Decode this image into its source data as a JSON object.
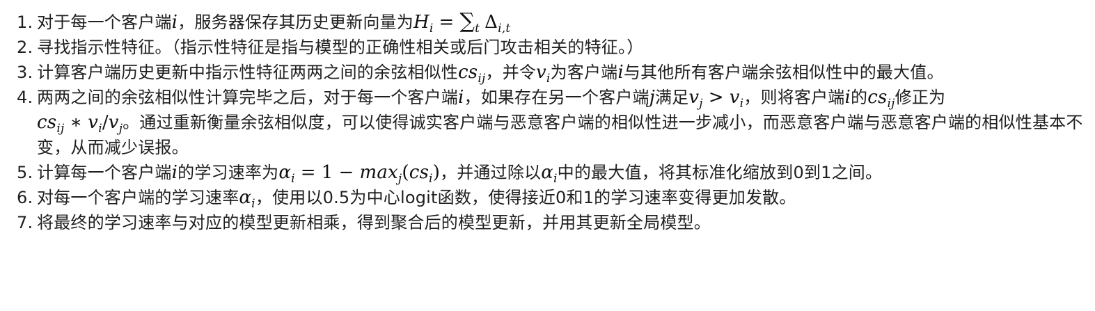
{
  "steps": [
    {
      "n": "1.",
      "t1": "对于每一个客户端",
      "t2": "，服务器保存其历史更新向量为",
      "m_i": "i",
      "m_H": "H",
      "m_H_sub": "i",
      "m_eq": "=",
      "m_sum": "∑",
      "m_sum_sub": "t",
      "m_delta": "Δ",
      "m_delta_sub": "i,t"
    },
    {
      "n": "2.",
      "text": "寻找指示性特征。（指示性特征是指与模型的正确性相关或后门攻击相关的特征。）"
    },
    {
      "n": "3.",
      "t1": "计算客户端历史更新中指示性特征两两之间的余弦相似性",
      "m_cs": "cs",
      "m_cs_sub": "ij",
      "t2": "，并令",
      "m_v": "v",
      "m_v_sub": "i",
      "t3": "为客户端",
      "m_i": "i",
      "t4": "与其他所有客户端余弦相似性中的最大值。"
    },
    {
      "n": "4.",
      "t1": "两两之间的余弦相似性计算完毕之后，对于每一个客户端",
      "m_i": "i",
      "t2": "，如果存在另一个客户端",
      "m_j": "j",
      "t3": "满足",
      "m_vj": "v",
      "m_vj_sub": "j",
      "m_gt": ">",
      "m_vi": "v",
      "m_vi_sub": "i",
      "t4": "，则将客户端",
      "m_i2": "i",
      "t5": "的",
      "m_cs": "cs",
      "m_cs_sub": "ij",
      "t6": "修正为",
      "m_cs2": "cs",
      "m_cs2_sub": "ij",
      "m_star": "∗",
      "m_v2": "v",
      "m_v2_sub": "i",
      "m_slash": "/",
      "m_v3": "v",
      "m_v3_sub": "j",
      "t7": "。通过重新衡量余弦相似度，可以使得诚实客户端与恶意客户端的相似性进一步减小，而恶意客户端与恶意客户端的相似性基本不变，从而减少误报。"
    },
    {
      "n": "5.",
      "t1": "计算每一个客户端",
      "m_i": "i",
      "t2": "的学习速率为",
      "m_alpha": "α",
      "m_alpha_sub": "i",
      "m_eq": "=",
      "m_one": "1",
      "m_minus": "−",
      "m_max": "max",
      "m_max_sub": "j",
      "m_lp": "(",
      "m_cs": "cs",
      "m_cs_sub": "i",
      "m_rp": ")",
      "t3": "，并通过除以",
      "m_alpha2": "α",
      "m_alpha2_sub": "i",
      "t4": "中的最大值，将其标准化缩放到0到1之间。"
    },
    {
      "n": "6.",
      "t1": "对每一个客户端的学习速率",
      "m_alpha": "α",
      "m_alpha_sub": "i",
      "t2": "，使用以0.5为中心logit函数，使得接近0和1的学习速率变得更加发散。"
    },
    {
      "n": "7.",
      "text": "将最终的学习速率与对应的模型更新相乘，得到聚合后的模型更新，并用其更新全局模型。"
    }
  ]
}
